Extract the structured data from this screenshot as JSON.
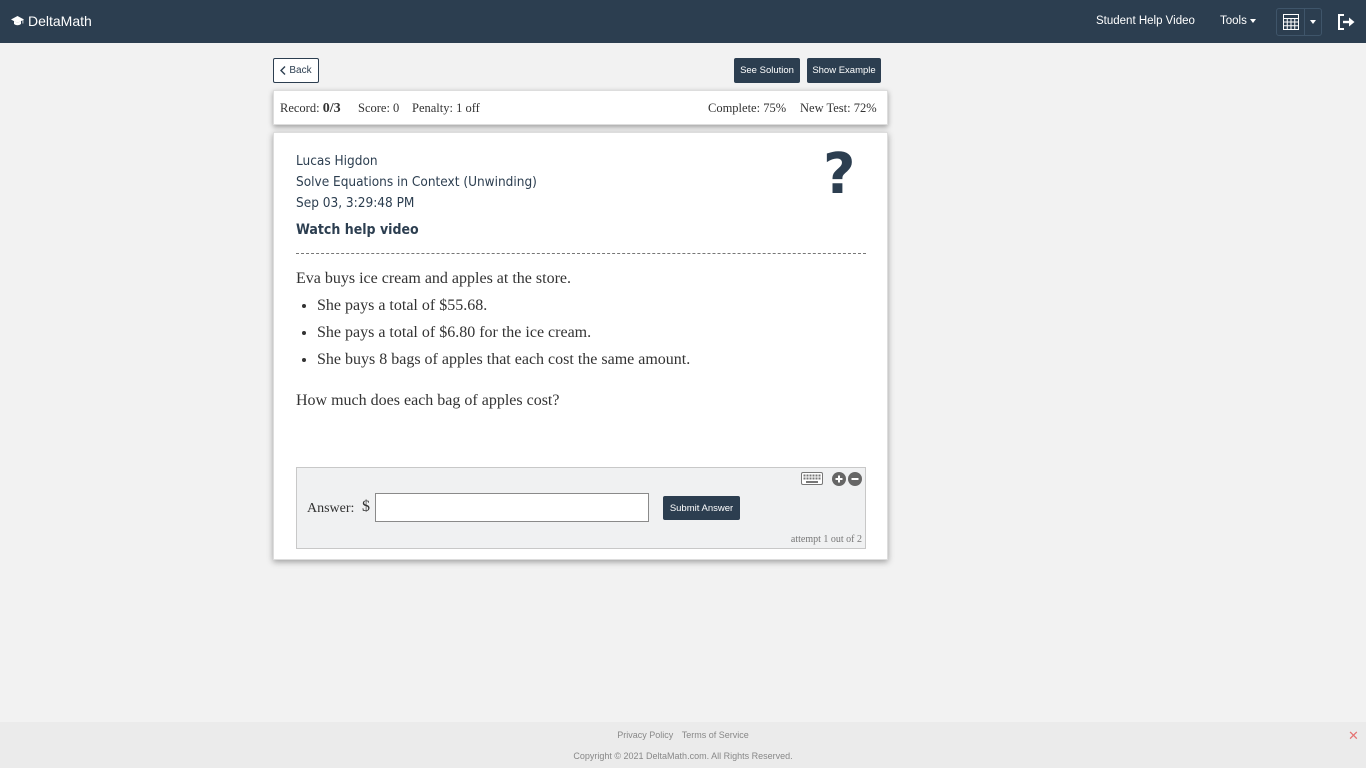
{
  "navbar": {
    "brand": "DeltaMath",
    "help_video": "Student Help Video",
    "tools": "Tools"
  },
  "actions": {
    "back": "Back",
    "see_solution": "See Solution",
    "show_example": "Show Example"
  },
  "record_bar": {
    "record_label": "Record:",
    "record_value": "0/3",
    "score": "Score: 0",
    "penalty": "Penalty: 1 off",
    "complete": "Complete: 75%",
    "new_test": "New Test: 72%"
  },
  "card": {
    "student": "Lucas Higdon",
    "skill": "Solve Equations in Context (Unwinding)",
    "date": "Sep 03, 3:29:48 PM",
    "watch_video": "Watch help video",
    "question_mark": "?"
  },
  "problem": {
    "intro": "Eva buys ice cream and apples at the store.",
    "bullets": [
      "She pays a total of $55.68.",
      "She pays a total of $6.80 for the ice cream.",
      "She buys 8 bags of apples that each cost the same amount."
    ],
    "question": "How much does each bag of apples cost?"
  },
  "answer": {
    "label": "Answer:",
    "currency": "$",
    "value": "",
    "submit": "Submit Answer",
    "attempt": "attempt 1 out of 2"
  },
  "footer": {
    "privacy": "Privacy Policy",
    "terms": "Terms of Service",
    "copyright": "Copyright © 2021 DeltaMath.com. All Rights Reserved.",
    "close": "✕"
  },
  "colors": {
    "navbar": "#2c3e50",
    "background": "#f2f2f2",
    "accent_button": "#2c3e50"
  }
}
